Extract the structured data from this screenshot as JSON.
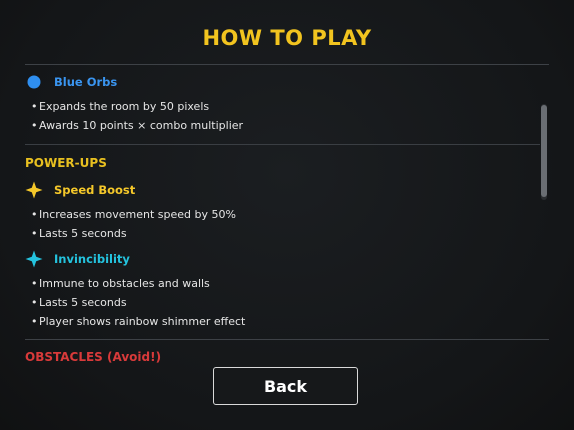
{
  "title": "HOW TO PLAY",
  "colors": {
    "title": "#f2c41f",
    "blue_orb": "#2f8ff0",
    "section_powerups": "#e8c020",
    "speed_boost": "#f5c82a",
    "invincibility": "#24c3de",
    "obstacles": "#d83a3a"
  },
  "orbs": {
    "blue": {
      "icon": "blue-circle",
      "label": "Blue Orbs",
      "bullets": [
        "Expands the room by 50 pixels",
        "Awards 10 points × combo multiplier"
      ]
    }
  },
  "powerups": {
    "section_title": "POWER-UPS",
    "items": [
      {
        "icon": "four-point-star",
        "label": "Speed Boost",
        "bullets": [
          "Increases movement speed by 50%",
          "Lasts 5 seconds"
        ]
      },
      {
        "icon": "four-point-star",
        "label": "Invincibility",
        "bullets": [
          "Immune to obstacles and walls",
          "Lasts 5 seconds",
          "Player shows rainbow shimmer effect"
        ]
      }
    ]
  },
  "obstacles": {
    "section_title": "OBSTACLES (Avoid!)"
  },
  "buttons": {
    "back": "Back"
  },
  "scroll": {
    "position": 0.2
  }
}
